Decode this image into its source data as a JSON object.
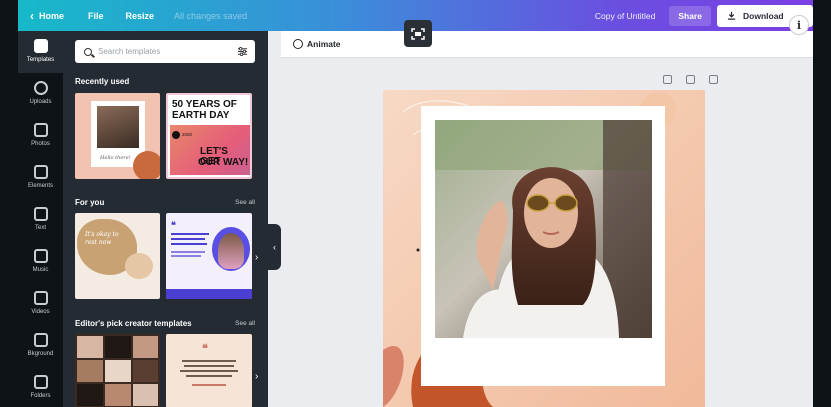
{
  "topbar": {
    "home_label": "Home",
    "file_label": "File",
    "resize_label": "Resize",
    "saved_status": "All changes saved",
    "doc_title": "Copy of Untitled",
    "share_label": "Share",
    "download_label": "Download"
  },
  "rail": {
    "items": [
      {
        "label": "Templates",
        "icon": "templates-icon"
      },
      {
        "label": "Uploads",
        "icon": "uploads-icon"
      },
      {
        "label": "Photos",
        "icon": "photos-icon"
      },
      {
        "label": "Elements",
        "icon": "elements-icon"
      },
      {
        "label": "Text",
        "icon": "text-icon"
      },
      {
        "label": "Music",
        "icon": "music-icon"
      },
      {
        "label": "Videos",
        "icon": "videos-icon"
      },
      {
        "label": "Bkground",
        "icon": "background-icon"
      },
      {
        "label": "Folders",
        "icon": "folders-icon"
      }
    ]
  },
  "panel": {
    "search_placeholder": "Search templates",
    "recently_used_title": "Recently used",
    "for_you_title": "For you",
    "editors_pick_title": "Editor's pick creator templates",
    "see_all_label": "See all",
    "earth_day_line1": "50 YEARS OF",
    "earth_day_line2": "EARTH DAY",
    "earth_day_line3": "LET'S GET",
    "earth_day_line4": "OUR WAY!",
    "earth_day_year": "2020",
    "hello_text": "Hello there!",
    "way_text": "It's okay to rest now"
  },
  "workspace": {
    "animate_label": "Animate"
  },
  "colors": {
    "accent_start": "#16b9c9",
    "accent_end": "#7b3fe4",
    "panel_bg": "#252b33",
    "rail_bg": "#0e1318",
    "design_bg": "#f6d1b8"
  }
}
